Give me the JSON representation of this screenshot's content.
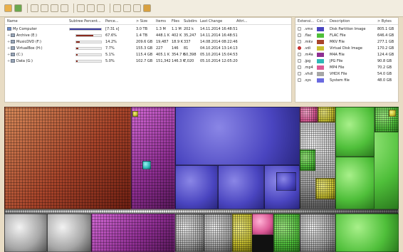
{
  "toolbar": {
    "buttons": [
      "open-icon",
      "refresh-icon",
      "copy-icon",
      "find-icon",
      "open-item-icon",
      "explorer-icon",
      "command-prompt-icon",
      "delete-icon",
      "properties-icon",
      "zoom-in-icon",
      "zoom-out-icon",
      "zoom-icon",
      "cleanup-icon"
    ]
  },
  "tree": {
    "columns": [
      "Name",
      "Subtree Percent...",
      "Perce...",
      "> Size",
      "Items",
      "Files",
      "Subdirs",
      "Last Change",
      "Attri..."
    ],
    "rows": [
      {
        "name": "My Computer",
        "percent_text": "[7:31 s]",
        "bar_pct": 100,
        "perc": "",
        "size": "3.0 TB",
        "items": "1.3 M",
        "files": "1.1 M",
        "subdirs": "202 k",
        "last_change": "14.11.2014 16:48:51",
        "attr": ""
      },
      {
        "name": "Archive (E:)",
        "percent_text": "67.6%",
        "bar_pct": 67.6,
        "perc": "",
        "size": "1.4 TB",
        "items": "448.1 K",
        "files": "402 K",
        "subdirs": "35,247",
        "last_change": "14.11.2014 16:48:51",
        "attr": ""
      },
      {
        "name": "MusicDVD (F:)",
        "percent_text": "14.2%",
        "bar_pct": 14.2,
        "perc": "",
        "size": "209.6 GB",
        "items": "19,487",
        "files": "18.9 K",
        "subdirs": "337",
        "last_change": "14.08.2014 08:22:46",
        "attr": ""
      },
      {
        "name": "VirtualBox (H:)",
        "percent_text": "7.7%",
        "bar_pct": 7.7,
        "perc": "",
        "size": "155.3 GB",
        "items": "227",
        "files": "146",
        "subdirs": "81",
        "last_change": "04.10.2014 13:14:13",
        "attr": ""
      },
      {
        "name": "(C:)",
        "percent_text": "5.1%",
        "bar_pct": 5.1,
        "perc": "",
        "size": "115.4 GB",
        "items": "405.1 K",
        "files": "354.7 K",
        "subdirs": "50,398",
        "last_change": "05.10.2014 15:04:53",
        "attr": ""
      },
      {
        "name": "Data (G:)",
        "percent_text": "5.0%",
        "bar_pct": 5.0,
        "perc": "",
        "size": "102.7 GB",
        "items": "151,342",
        "files": "146.3 K",
        "subdirs": "7,020",
        "last_change": "05.10.2014 12:05:20",
        "attr": ""
      }
    ]
  },
  "ext": {
    "columns": [
      "Extensi...",
      "Col...",
      "Description",
      "> Bytes"
    ],
    "rows": [
      {
        "ext": ".vmx",
        "color": "#4a45c0",
        "desc": "Disk Partition Image",
        "bytes": "805.1 GB"
      },
      {
        "ext": ".flac",
        "color": "#4fbf3a",
        "desc": "FLAC File",
        "bytes": "646.4 GB"
      },
      {
        "ext": ".mkv",
        "color": "#a8442a",
        "desc": "MKV File",
        "bytes": "277.1 GB"
      },
      {
        "ext": ".vdi",
        "color": "#c8c030",
        "desc": "Virtual Disk Image",
        "bytes": "170.2 GB"
      },
      {
        "ext": ".m4a",
        "color": "#8e2e92",
        "desc": "M4A File",
        "bytes": "124.4 GB"
      },
      {
        "ext": ".jpg",
        "color": "#2fb8b8",
        "desc": "JPG File",
        "bytes": "90.8 GB"
      },
      {
        "ext": ".mp4",
        "color": "#dc5a96",
        "desc": "MP4 File",
        "bytes": "70.2 GB"
      },
      {
        "ext": ".vhdl",
        "color": "#a6a6a6",
        "desc": "VHDX File",
        "bytes": "54.0 GB"
      },
      {
        "ext": ".sys",
        "color": "#6a6ae0",
        "desc": "System file",
        "bytes": "48.0 GB"
      }
    ]
  },
  "treemap_legend": {
    "blue": "#4a45c0",
    "red": "#a8442a",
    "magenta": "#8e2e92",
    "green": "#4fbf3a",
    "yellow": "#c8c030",
    "gray": "#a6a6a6",
    "pink": "#dc5a96",
    "cyan": "#2fb8b8"
  }
}
